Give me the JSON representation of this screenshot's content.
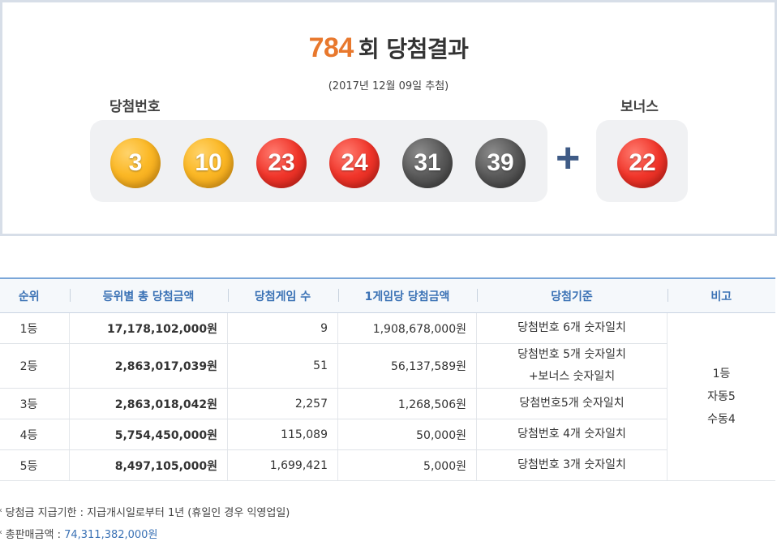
{
  "result": {
    "round": "784",
    "title_suffix": "회 당첨결과",
    "date": "(2017년 12월 09일 추첨)",
    "winning_label": "당첨번호",
    "bonus_label": "보너스",
    "plus": "+",
    "numbers": [
      "3",
      "10",
      "23",
      "24",
      "31",
      "39"
    ],
    "bonus": "22",
    "ball_colors": {
      "yellow": "#fbb826",
      "red": "#f0352a",
      "gray": "#585858"
    }
  },
  "table": {
    "headers": [
      "순위",
      "등위별 총 당첨금액",
      "당첨게임 수",
      "1게임당 당첨금액",
      "당첨기준",
      "비고"
    ],
    "rows": [
      {
        "rank": "1등",
        "total": "17,178,102,000원",
        "count": "9",
        "per_game": "1,908,678,000원",
        "criteria": "당첨번호 6개 숫자일치",
        "criteria_extra": ""
      },
      {
        "rank": "2등",
        "total": "2,863,017,039원",
        "count": "51",
        "per_game": "56,137,589원",
        "criteria": "당첨번호 5개 숫자일치",
        "criteria_extra": "+보너스 숫자일치"
      },
      {
        "rank": "3등",
        "total": "2,863,018,042원",
        "count": "2,257",
        "per_game": "1,268,506원",
        "criteria": "당첨번호5개 숫자일치",
        "criteria_extra": ""
      },
      {
        "rank": "4등",
        "total": "5,754,450,000원",
        "count": "115,089",
        "per_game": "50,000원",
        "criteria": "당첨번호 4개 숫자일치",
        "criteria_extra": ""
      },
      {
        "rank": "5등",
        "total": "8,497,105,000원",
        "count": "1,699,421",
        "per_game": "5,000원",
        "criteria": "당첨번호 3개 숫자일치",
        "criteria_extra": ""
      }
    ],
    "note": [
      "1등",
      "자동5",
      "수동4"
    ]
  },
  "footnotes": {
    "deadline_label": "* 당첨금 지급기한 : 지급개시일로부터 1년 (휴일인 경우 익영업일)",
    "sales_label": "* 총판매금액 : ",
    "sales_value": "74,311,382,000원"
  }
}
